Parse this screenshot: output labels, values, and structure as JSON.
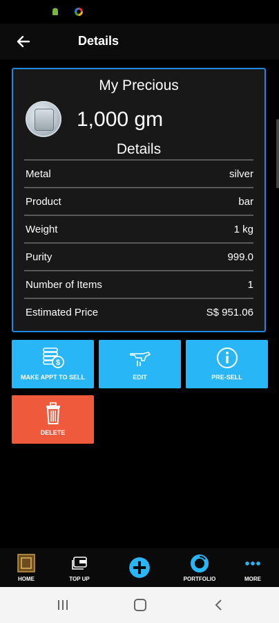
{
  "appbar": {
    "title": "Details"
  },
  "card": {
    "title": "My Precious",
    "weight": "1,000 gm",
    "details_heading": "Details",
    "rows": [
      {
        "label": "Metal",
        "value": "silver"
      },
      {
        "label": "Product",
        "value": "bar"
      },
      {
        "label": "Weight",
        "value": "1 kg"
      },
      {
        "label": "Purity",
        "value": "999.0"
      },
      {
        "label": "Number of Items",
        "value": "1"
      },
      {
        "label": "Estimated Price",
        "value": "S$ 951.06"
      }
    ]
  },
  "actions": {
    "appt": "MAKE APPT TO SELL",
    "edit": "EDIT",
    "presell": "PRE-SELL",
    "delete": "DELETE"
  },
  "nav": {
    "home": "HOME",
    "topup": "TOP UP",
    "portfolio": "PORTFOLIO",
    "more": "MORE"
  },
  "colors": {
    "accent_blue": "#29b6f6",
    "card_border": "#1e88e5",
    "delete_red": "#ef5a3c",
    "background": "#000000"
  }
}
